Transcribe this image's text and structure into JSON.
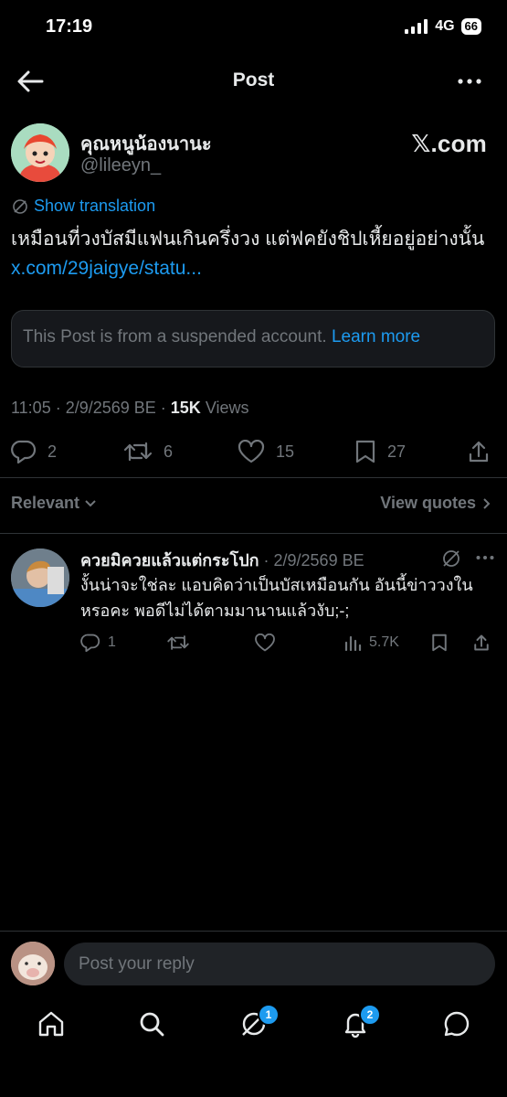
{
  "status_bar": {
    "time": "17:19",
    "network": "4G",
    "battery": "66"
  },
  "header": {
    "title": "Post"
  },
  "post": {
    "display_name": "คุณหนูน้องนานะ",
    "handle": "@lileeyn_",
    "source": "𝕏.com",
    "translate_label": "Show translation",
    "text": "เหมือนที่วงบัสมีแฟนเกินครึ่งวง แต่ฟคยังชิปเหี้ยอยู่อย่างนั้น ",
    "link": "x.com/29jaigye/statu...",
    "quote_notice": "This Post is from a suspended account. ",
    "learn_more": "Learn more",
    "timestamp": "11:05 · 2/9/2569 BE · ",
    "views_count": "15K",
    "views_label": " Views",
    "replies": "2",
    "reposts": "6",
    "likes": "15",
    "bookmarks": "27"
  },
  "filters": {
    "sort_label": "Relevant",
    "view_quotes": "View quotes"
  },
  "reply": {
    "name": "ควยมิควยแล้วแต่กระโปก",
    "date": " · 2/9/2569 BE",
    "text": "งั้นน่าจะใช่ละ แอบคิดว่าเป็นบัสเหมือนกัน อันนี้ข่าววงในหรอคะ พอดีไม่ได้ตามมานานแล้วงับ;-;",
    "replies": "1",
    "views": "5.7K"
  },
  "composer": {
    "placeholder": "Post your reply"
  },
  "nav": {
    "grok_badge": "1",
    "notifications_badge": "2"
  },
  "colors": {
    "accent": "#1d9bf0",
    "muted": "#71767b",
    "text": "#e7e9ea",
    "background": "#000000"
  }
}
